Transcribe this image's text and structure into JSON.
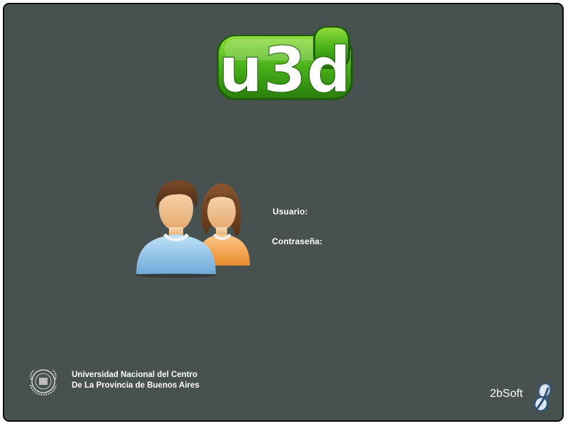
{
  "app": {
    "logo_text": "u3d",
    "logo_color": "#3a9a12"
  },
  "login": {
    "username_label": "Usuario:",
    "password_label": "Contraseña:",
    "username_value": "",
    "password_value": "",
    "users_icon": "users-icon"
  },
  "footer": {
    "university_line1": "Universidad Nacional del Centro",
    "university_line2": "De La Provincia de Buenos Aires",
    "seal_icon": "university-seal-icon",
    "brand_name": "2bSoft",
    "brand_icon": "2bsoft-logo-icon"
  },
  "colors": {
    "background": "#475150",
    "frame_border": "#0b0d0d",
    "text": "#ffffff"
  }
}
